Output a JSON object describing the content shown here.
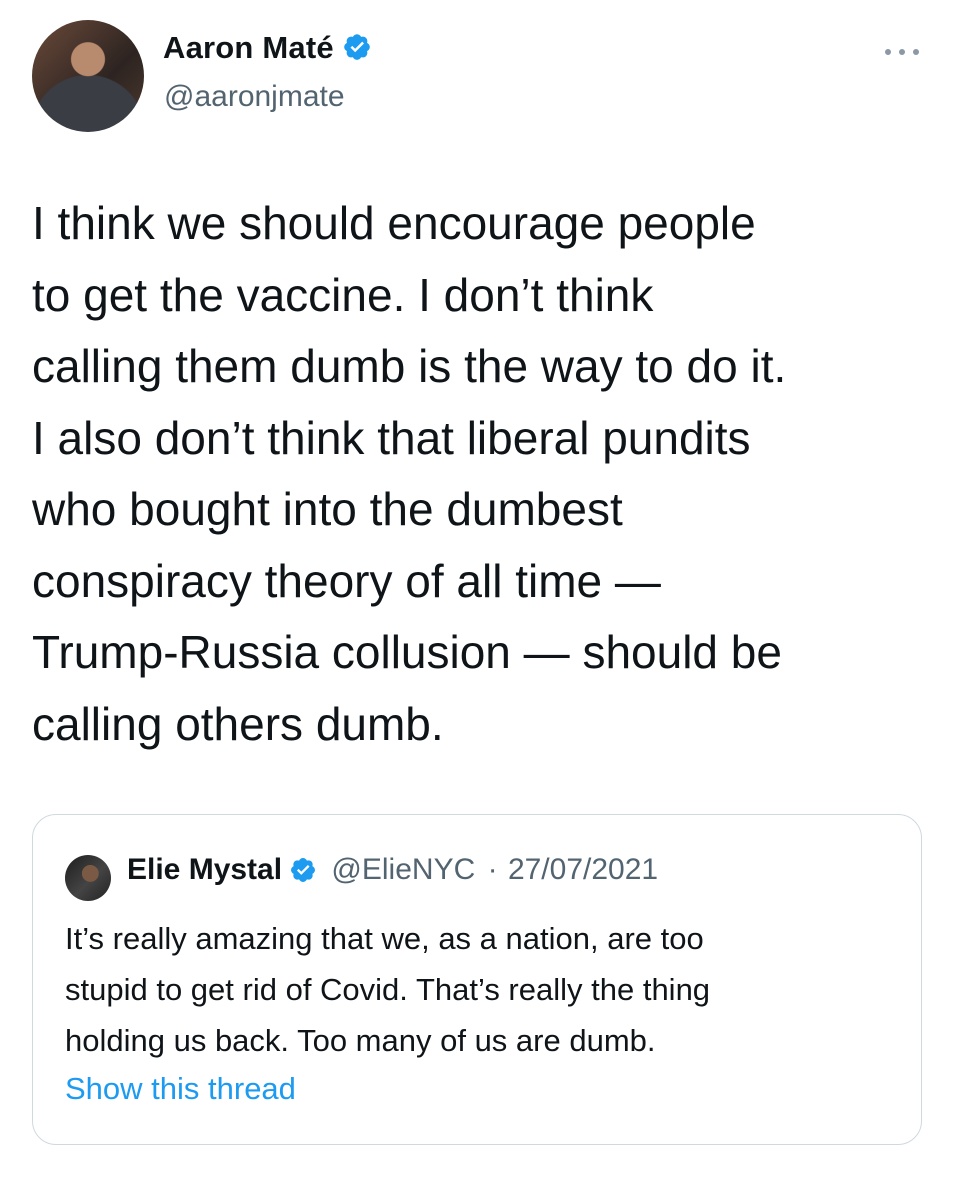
{
  "author": {
    "name": "Aaron Maté",
    "handle": "@aaronjmate",
    "verified": true,
    "avatar_icon": "profile-photo"
  },
  "tweet": {
    "lines": [
      "I think we should encourage people",
      "to get the vaccine. I don’t think",
      "calling them dumb is the way to do it.",
      "I also don’t think that liberal pundits",
      "who bought into the dumbest",
      "conspiracy theory of all time —",
      "Trump-Russia collusion — should be",
      "calling others dumb."
    ]
  },
  "quoted": {
    "name": "Elie Mystal",
    "handle": "@ElieNYC",
    "separator": "·",
    "date": "27/07/2021",
    "verified": true,
    "lines": [
      "It’s really amazing that we, as a nation, are too",
      "stupid to get rid of Covid. That’s really the thing",
      "holding us back. Too many of us are dumb."
    ],
    "show_thread": "Show this thread"
  },
  "colors": {
    "verified_blue": "#1d9bf0",
    "secondary_text": "#536471",
    "border": "#cfd9de"
  },
  "icons": [
    "verified-badge-icon",
    "more-options-icon"
  ]
}
